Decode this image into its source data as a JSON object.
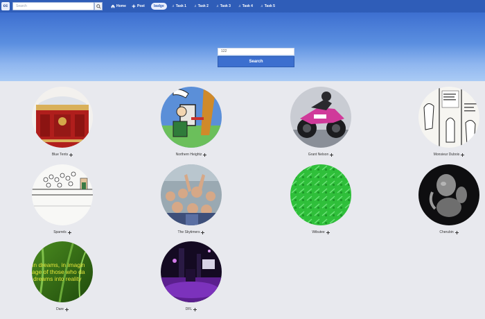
{
  "topbar": {
    "logo": "cc",
    "search_placeholder": "Search",
    "nav": [
      {
        "label": "Home",
        "icon": "home-icon"
      },
      {
        "label": "Post",
        "icon": "plus-icon"
      },
      {
        "label": "Task 1",
        "icon": "music-note-icon"
      },
      {
        "label": "Task 2",
        "icon": "music-note-icon"
      },
      {
        "label": "Task 3",
        "icon": "music-note-icon"
      },
      {
        "label": "Task 4",
        "icon": "music-note-icon"
      },
      {
        "label": "Task 5",
        "icon": "music-note-icon"
      }
    ],
    "badge": "badge"
  },
  "hero": {
    "search_value": "122",
    "search_button": "Search"
  },
  "cards": [
    {
      "label": "Blue Tents"
    },
    {
      "label": "Northern Heightz"
    },
    {
      "label": "Grant Nelson"
    },
    {
      "label": "Monsieur Dubois"
    },
    {
      "label": "Sparrels"
    },
    {
      "label": "The Skytimers"
    },
    {
      "label": "Wibutee"
    },
    {
      "label": "Cherubin"
    },
    {
      "label": "Dare"
    },
    {
      "label": "DFL"
    }
  ],
  "images": {
    "dare_overlay_lines": [
      "In dreams, in imagin",
      "age of those who da",
      "dreams into reality"
    ]
  },
  "colors": {
    "nav_bg": "#2f5db8",
    "hero_top": "#3d6fd0",
    "hero_bottom": "#aacbf5",
    "page_bg": "#e8e9ee"
  }
}
